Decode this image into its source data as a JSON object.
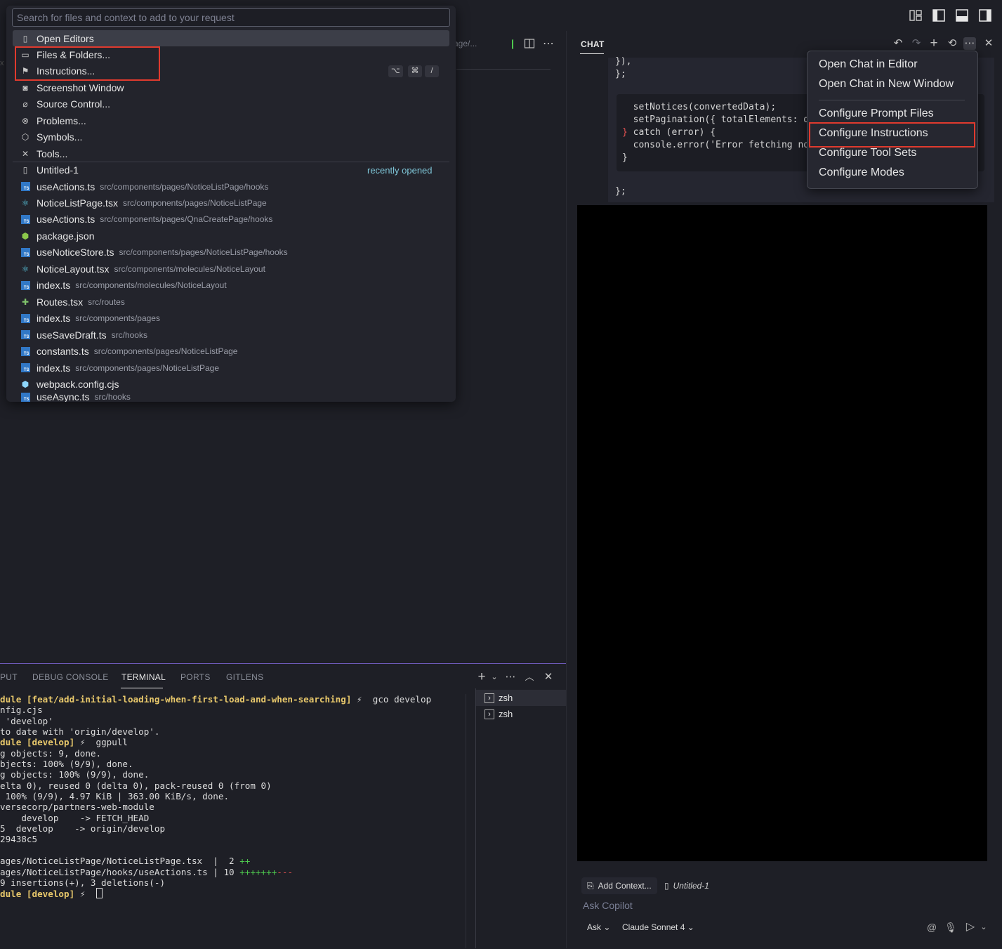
{
  "titlebar": {
    "layout_icons": [
      "customize-layout-icon",
      "toggle-primary-sidebar-icon",
      "toggle-panel-icon",
      "toggle-secondary-sidebar-icon"
    ]
  },
  "editor": {
    "tab_fragment": "age/..."
  },
  "quick_pick": {
    "placeholder": "Search for files and context to add to your request",
    "context_items": [
      {
        "label": "Open Editors",
        "icon": "file-icon"
      },
      {
        "label": "Files & Folders...",
        "icon": "folder-icon"
      },
      {
        "label": "Instructions...",
        "icon": "bookmark-icon"
      },
      {
        "label": "Screenshot Window",
        "icon": "camera-icon"
      },
      {
        "label": "Source Control...",
        "icon": "source-control-icon"
      },
      {
        "label": "Problems...",
        "icon": "error-icon"
      },
      {
        "label": "Symbols...",
        "icon": "symbol-icon"
      },
      {
        "label": "Tools...",
        "icon": "tools-icon"
      }
    ],
    "shortcut_keys": [
      "⌥",
      "⌘",
      "/"
    ],
    "recent_label": "recently opened",
    "files": [
      {
        "name": "Untitled-1",
        "path": "",
        "icon": "file-icon"
      },
      {
        "name": "useActions.ts",
        "path": "src/components/pages/NoticeListPage/hooks",
        "icon": "ts-icon"
      },
      {
        "name": "NoticeListPage.tsx",
        "path": "src/components/pages/NoticeListPage",
        "icon": "react-icon"
      },
      {
        "name": "useActions.ts",
        "path": "src/components/pages/QnaCreatePage/hooks",
        "icon": "ts-icon"
      },
      {
        "name": "package.json",
        "path": "",
        "icon": "node-icon"
      },
      {
        "name": "useNoticeStore.ts",
        "path": "src/components/pages/NoticeListPage/hooks",
        "icon": "ts-icon"
      },
      {
        "name": "NoticeLayout.tsx",
        "path": "src/components/molecules/NoticeLayout",
        "icon": "react-icon"
      },
      {
        "name": "index.ts",
        "path": "src/components/molecules/NoticeLayout",
        "icon": "ts-icon"
      },
      {
        "name": "Routes.tsx",
        "path": "src/routes",
        "icon": "routes-icon"
      },
      {
        "name": "index.ts",
        "path": "src/components/pages",
        "icon": "ts-icon"
      },
      {
        "name": "useSaveDraft.ts",
        "path": "src/hooks",
        "icon": "ts-icon"
      },
      {
        "name": "constants.ts",
        "path": "src/components/pages/NoticeListPage",
        "icon": "ts-icon"
      },
      {
        "name": "index.ts",
        "path": "src/components/pages/NoticeListPage",
        "icon": "ts-icon"
      },
      {
        "name": "webpack.config.cjs",
        "path": "",
        "icon": "webpack-icon"
      },
      {
        "name": "useAsync.ts",
        "path": "src/hooks",
        "icon": "ts-icon"
      }
    ]
  },
  "chat": {
    "title": "CHAT",
    "code_lines": [
      "}),",
      "};"
    ],
    "inner_code_lines": [
      "  setNotices(convertedData);",
      "  setPagination({ totalElements: d",
      "} catch (error) {",
      "  console.error('Error fetching no",
      "}"
    ],
    "code_after": "};",
    "menu": {
      "items": [
        "Open Chat in Editor",
        "Open Chat in New Window",
        "Configure Prompt Files",
        "Configure Instructions",
        "Configure Tool Sets",
        "Configure Modes"
      ]
    },
    "input": {
      "add_context": "Add Context...",
      "attached_file": "Untitled-1",
      "placeholder": "Ask Copilot",
      "mode": "Ask",
      "model": "Claude Sonnet 4"
    }
  },
  "panel": {
    "tabs": [
      "PUT",
      "DEBUG CONSOLE",
      "TERMINAL",
      "PORTS",
      "GITLENS"
    ],
    "active_tab": "TERMINAL",
    "terminals": [
      "zsh",
      "zsh"
    ],
    "terminal_lines": {
      "l1_branch": "dule [feat/add-initial-loading-when-first-load-and-when-searching]",
      "l1_cmd": " ⚡  gco develop",
      "l2": "nfig.cjs",
      "l3": " 'develop'",
      "l4": "to date with 'origin/develop'.",
      "l5_branch": "dule [develop]",
      "l5_cmd": " ⚡  ggpull",
      "l6": "g objects: 9, done.",
      "l7": "bjects: 100% (9/9), done.",
      "l8": "g objects: 100% (9/9), done.",
      "l9": "elta 0), reused 0 (delta 0), pack-reused 0 (from 0)",
      "l10": " 100% (9/9), 4.97 KiB | 363.00 KiB/s, done.",
      "l11": "versecorp/partners-web-module",
      "l12": "    develop    -> FETCH_HEAD",
      "l13": "5  develop    -> origin/develop",
      "l14": "29438c5",
      "l15": "",
      "l16_a": "ages/NoticeListPage/NoticeListPage.tsx  |  2 ",
      "l16_plus": "++",
      "l17_a": "ages/NoticeListPage/hooks/useActions.ts | 10 ",
      "l17_plus": "+++++++",
      "l17_minus": "---",
      "l18": "9 insertions(+), 3 deletions(-)",
      "l19_branch": "dule [develop]",
      "l19_cmd": " ⚡  "
    }
  },
  "colors": {
    "accent_highlight": "#e03a2e",
    "recent_label": "#7fc7d9",
    "terminal_branch": "#e8c86b"
  }
}
